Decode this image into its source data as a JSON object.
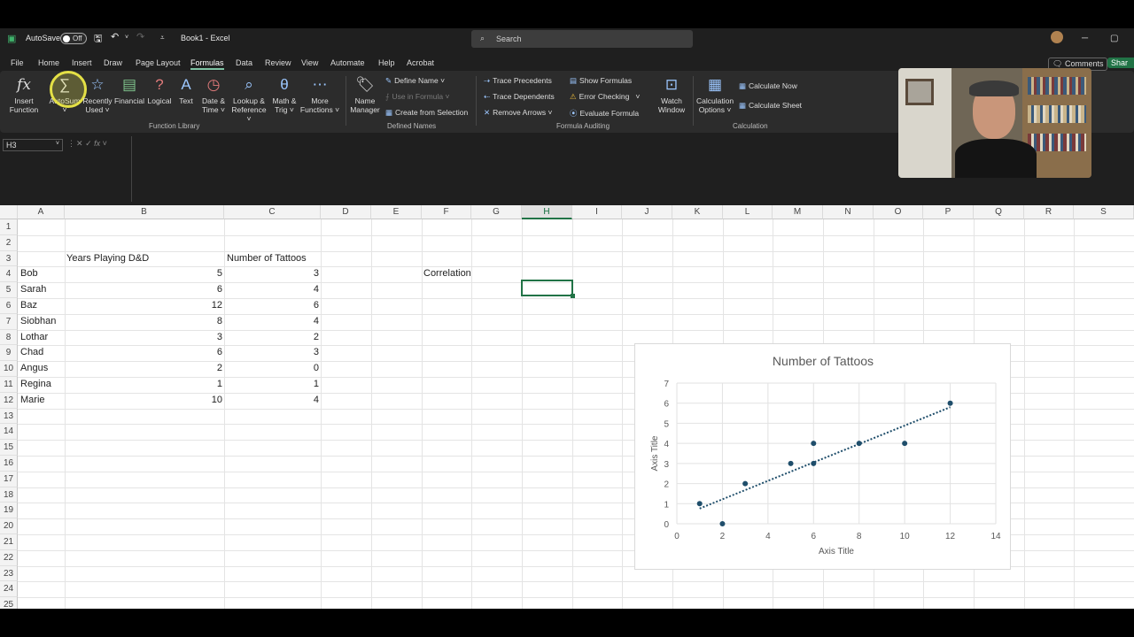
{
  "titlebar": {
    "autosave_label": "AutoSave",
    "autosave_state": "Off",
    "title": "Book1 - Excel",
    "search_placeholder": "Search"
  },
  "menu": {
    "items": [
      "File",
      "Home",
      "Insert",
      "Draw",
      "Page Layout",
      "Formulas",
      "Data",
      "Review",
      "View",
      "Automate",
      "Help",
      "Acrobat"
    ],
    "active": "Formulas",
    "comments": "Comments",
    "share": "Shar"
  },
  "ribbon": {
    "insert_function": [
      "Insert",
      "Function"
    ],
    "autosum": "AutoSum",
    "recently_used": [
      "Recently",
      "Used ˅"
    ],
    "financial": "Financial",
    "logical": "Logical",
    "text": "Text",
    "date_time": [
      "Date &",
      "Time ˅"
    ],
    "lookup": [
      "Lookup &",
      "Reference ˅"
    ],
    "math": [
      "Math &",
      "Trig ˅"
    ],
    "more": [
      "More",
      "Functions ˅"
    ],
    "function_library": "Function Library",
    "name_manager": [
      "Name",
      "Manager"
    ],
    "define_name": "Define Name",
    "use_in_formula": "Use in Formula",
    "create_from_selection": "Create from Selection",
    "defined_names": "Defined Names",
    "trace_precedents": "Trace Precedents",
    "trace_dependents": "Trace Dependents",
    "remove_arrows": "Remove Arrows",
    "show_formulas": "Show Formulas",
    "error_checking": "Error Checking",
    "evaluate_formula": "Evaluate Formula",
    "formula_auditing": "Formula Auditing",
    "watch_window": [
      "Watch",
      "Window"
    ],
    "calc_options": [
      "Calculation",
      "Options ˅"
    ],
    "calculate_now": "Calculate Now",
    "calculate_sheet": "Calculate Sheet",
    "calculation": "Calculation"
  },
  "formula_bar": {
    "name_box": "H3",
    "fx": "fx",
    "formula": ""
  },
  "columns": [
    "A",
    "B",
    "C",
    "D",
    "E",
    "F",
    "G",
    "H",
    "I",
    "J",
    "K",
    "L",
    "M",
    "N",
    "O",
    "P",
    "Q",
    "R",
    "S"
  ],
  "selected_column": "H",
  "rows": [
    "1",
    "2",
    "3",
    "4",
    "5",
    "6",
    "7",
    "8",
    "9",
    "10",
    "11",
    "12",
    "13",
    "14",
    "15",
    "16",
    "17",
    "18",
    "19",
    "20",
    "21",
    "22",
    "23",
    "24",
    "25"
  ],
  "headers": {
    "b2": "Years Playing D&D",
    "c2": "Number of Tattoos"
  },
  "table": [
    {
      "name": "Bob",
      "years": "5",
      "tattoos": "3"
    },
    {
      "name": "Sarah",
      "years": "6",
      "tattoos": "4"
    },
    {
      "name": "Baz",
      "years": "12",
      "tattoos": "6"
    },
    {
      "name": "Siobhan",
      "years": "8",
      "tattoos": "4"
    },
    {
      "name": "Lothar",
      "years": "3",
      "tattoos": "2"
    },
    {
      "name": "Chad",
      "years": "6",
      "tattoos": "3"
    },
    {
      "name": "Angus",
      "years": "2",
      "tattoos": "0"
    },
    {
      "name": "Regina",
      "years": "1",
      "tattoos": "1"
    },
    {
      "name": "Marie",
      "years": "10",
      "tattoos": "4"
    }
  ],
  "f3_label": "Correlation",
  "colors": {
    "accent": "#217346",
    "marker": "#1f4e6b",
    "ribbon_icon": "#9cc7ff"
  },
  "chart_data": {
    "type": "scatter",
    "title": "Number of Tattoos",
    "xlabel": "Axis Title",
    "ylabel": "Axis Title",
    "xlim": [
      0,
      14
    ],
    "ylim": [
      0,
      7
    ],
    "xticks": [
      "0",
      "2",
      "4",
      "6",
      "8",
      "10",
      "12",
      "14"
    ],
    "yticks": [
      "0",
      "1",
      "2",
      "3",
      "4",
      "5",
      "6",
      "7"
    ],
    "grid": true,
    "trendline": "linear, dotted",
    "points": [
      [
        5,
        3
      ],
      [
        6,
        4
      ],
      [
        12,
        6
      ],
      [
        8,
        4
      ],
      [
        3,
        2
      ],
      [
        6,
        3
      ],
      [
        2,
        0
      ],
      [
        1,
        1
      ],
      [
        10,
        4
      ]
    ]
  }
}
